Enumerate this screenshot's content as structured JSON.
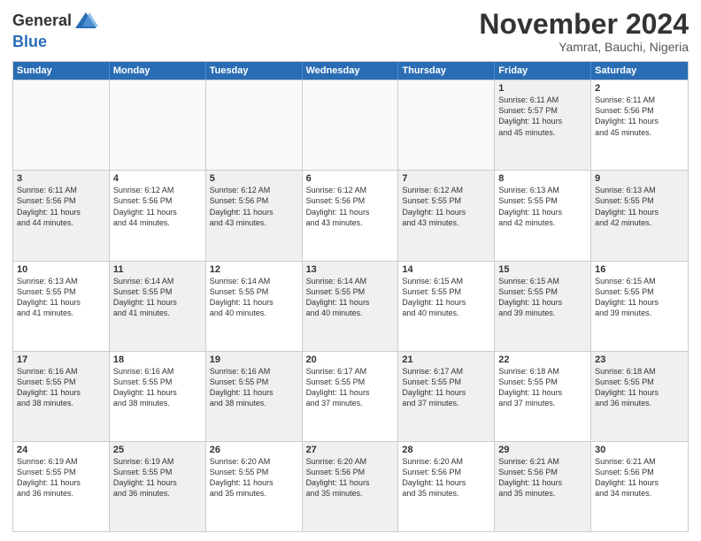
{
  "header": {
    "logo_general": "General",
    "logo_blue": "Blue",
    "month_title": "November 2024",
    "location": "Yamrat, Bauchi, Nigeria"
  },
  "weekdays": [
    "Sunday",
    "Monday",
    "Tuesday",
    "Wednesday",
    "Thursday",
    "Friday",
    "Saturday"
  ],
  "weeks": [
    [
      {
        "day": "",
        "info": "",
        "empty": true
      },
      {
        "day": "",
        "info": "",
        "empty": true
      },
      {
        "day": "",
        "info": "",
        "empty": true
      },
      {
        "day": "",
        "info": "",
        "empty": true
      },
      {
        "day": "",
        "info": "",
        "empty": true
      },
      {
        "day": "1",
        "info": "Sunrise: 6:11 AM\nSunset: 5:57 PM\nDaylight: 11 hours\nand 45 minutes.",
        "shaded": true
      },
      {
        "day": "2",
        "info": "Sunrise: 6:11 AM\nSunset: 5:56 PM\nDaylight: 11 hours\nand 45 minutes.",
        "shaded": false
      }
    ],
    [
      {
        "day": "3",
        "info": "Sunrise: 6:11 AM\nSunset: 5:56 PM\nDaylight: 11 hours\nand 44 minutes.",
        "shaded": true
      },
      {
        "day": "4",
        "info": "Sunrise: 6:12 AM\nSunset: 5:56 PM\nDaylight: 11 hours\nand 44 minutes.",
        "shaded": false
      },
      {
        "day": "5",
        "info": "Sunrise: 6:12 AM\nSunset: 5:56 PM\nDaylight: 11 hours\nand 43 minutes.",
        "shaded": true
      },
      {
        "day": "6",
        "info": "Sunrise: 6:12 AM\nSunset: 5:56 PM\nDaylight: 11 hours\nand 43 minutes.",
        "shaded": false
      },
      {
        "day": "7",
        "info": "Sunrise: 6:12 AM\nSunset: 5:55 PM\nDaylight: 11 hours\nand 43 minutes.",
        "shaded": true
      },
      {
        "day": "8",
        "info": "Sunrise: 6:13 AM\nSunset: 5:55 PM\nDaylight: 11 hours\nand 42 minutes.",
        "shaded": false
      },
      {
        "day": "9",
        "info": "Sunrise: 6:13 AM\nSunset: 5:55 PM\nDaylight: 11 hours\nand 42 minutes.",
        "shaded": true
      }
    ],
    [
      {
        "day": "10",
        "info": "Sunrise: 6:13 AM\nSunset: 5:55 PM\nDaylight: 11 hours\nand 41 minutes.",
        "shaded": false
      },
      {
        "day": "11",
        "info": "Sunrise: 6:14 AM\nSunset: 5:55 PM\nDaylight: 11 hours\nand 41 minutes.",
        "shaded": true
      },
      {
        "day": "12",
        "info": "Sunrise: 6:14 AM\nSunset: 5:55 PM\nDaylight: 11 hours\nand 40 minutes.",
        "shaded": false
      },
      {
        "day": "13",
        "info": "Sunrise: 6:14 AM\nSunset: 5:55 PM\nDaylight: 11 hours\nand 40 minutes.",
        "shaded": true
      },
      {
        "day": "14",
        "info": "Sunrise: 6:15 AM\nSunset: 5:55 PM\nDaylight: 11 hours\nand 40 minutes.",
        "shaded": false
      },
      {
        "day": "15",
        "info": "Sunrise: 6:15 AM\nSunset: 5:55 PM\nDaylight: 11 hours\nand 39 minutes.",
        "shaded": true
      },
      {
        "day": "16",
        "info": "Sunrise: 6:15 AM\nSunset: 5:55 PM\nDaylight: 11 hours\nand 39 minutes.",
        "shaded": false
      }
    ],
    [
      {
        "day": "17",
        "info": "Sunrise: 6:16 AM\nSunset: 5:55 PM\nDaylight: 11 hours\nand 38 minutes.",
        "shaded": true
      },
      {
        "day": "18",
        "info": "Sunrise: 6:16 AM\nSunset: 5:55 PM\nDaylight: 11 hours\nand 38 minutes.",
        "shaded": false
      },
      {
        "day": "19",
        "info": "Sunrise: 6:16 AM\nSunset: 5:55 PM\nDaylight: 11 hours\nand 38 minutes.",
        "shaded": true
      },
      {
        "day": "20",
        "info": "Sunrise: 6:17 AM\nSunset: 5:55 PM\nDaylight: 11 hours\nand 37 minutes.",
        "shaded": false
      },
      {
        "day": "21",
        "info": "Sunrise: 6:17 AM\nSunset: 5:55 PM\nDaylight: 11 hours\nand 37 minutes.",
        "shaded": true
      },
      {
        "day": "22",
        "info": "Sunrise: 6:18 AM\nSunset: 5:55 PM\nDaylight: 11 hours\nand 37 minutes.",
        "shaded": false
      },
      {
        "day": "23",
        "info": "Sunrise: 6:18 AM\nSunset: 5:55 PM\nDaylight: 11 hours\nand 36 minutes.",
        "shaded": true
      }
    ],
    [
      {
        "day": "24",
        "info": "Sunrise: 6:19 AM\nSunset: 5:55 PM\nDaylight: 11 hours\nand 36 minutes.",
        "shaded": false
      },
      {
        "day": "25",
        "info": "Sunrise: 6:19 AM\nSunset: 5:55 PM\nDaylight: 11 hours\nand 36 minutes.",
        "shaded": true
      },
      {
        "day": "26",
        "info": "Sunrise: 6:20 AM\nSunset: 5:55 PM\nDaylight: 11 hours\nand 35 minutes.",
        "shaded": false
      },
      {
        "day": "27",
        "info": "Sunrise: 6:20 AM\nSunset: 5:56 PM\nDaylight: 11 hours\nand 35 minutes.",
        "shaded": true
      },
      {
        "day": "28",
        "info": "Sunrise: 6:20 AM\nSunset: 5:56 PM\nDaylight: 11 hours\nand 35 minutes.",
        "shaded": false
      },
      {
        "day": "29",
        "info": "Sunrise: 6:21 AM\nSunset: 5:56 PM\nDaylight: 11 hours\nand 35 minutes.",
        "shaded": true
      },
      {
        "day": "30",
        "info": "Sunrise: 6:21 AM\nSunset: 5:56 PM\nDaylight: 11 hours\nand 34 minutes.",
        "shaded": false
      }
    ]
  ]
}
